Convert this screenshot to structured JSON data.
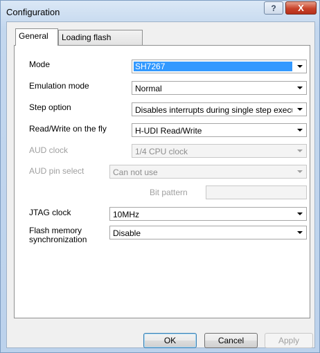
{
  "window": {
    "title": "Configuration",
    "help_symbol": "?",
    "close_symbol": "X"
  },
  "tabs": [
    {
      "label": "General"
    },
    {
      "label": "Loading flash memory"
    }
  ],
  "general": {
    "mode": {
      "label": "Mode",
      "value": "SH7267"
    },
    "emulation_mode": {
      "label": "Emulation mode",
      "value": "Normal"
    },
    "step_option": {
      "label": "Step option",
      "value": "Disables interrupts during single step executi"
    },
    "read_write_fly": {
      "label": "Read/Write on the fly",
      "value": "H-UDI Read/Write"
    },
    "aud_clock": {
      "label": "AUD clock",
      "value": "1/4 CPU clock"
    },
    "aud_pin_select": {
      "label": "AUD pin select",
      "value": "Can not use"
    },
    "bit_pattern": {
      "label": "Bit pattern",
      "value": ""
    },
    "jtag_clock": {
      "label": "JTAG clock",
      "value": "10MHz"
    },
    "flash_sync": {
      "label_line1": "Flash memory",
      "label_line2": "synchronization",
      "value": "Disable"
    }
  },
  "buttons": {
    "ok": "OK",
    "cancel": "Cancel",
    "apply": "Apply"
  },
  "icons": {
    "help": "help-icon",
    "close": "close-icon",
    "dropdown": "chevron-down-icon"
  }
}
